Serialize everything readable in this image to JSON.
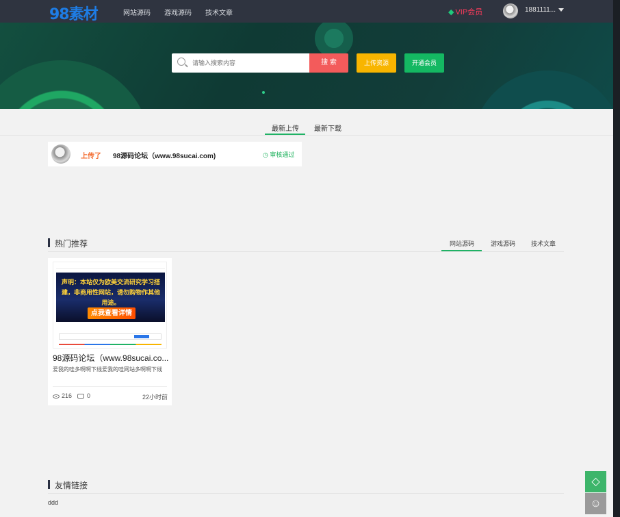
{
  "header": {
    "logo": "98素材",
    "nav": [
      "网站源码",
      "游戏源码",
      "技术文章"
    ],
    "vip_label": "VIP会员",
    "user_name": "1881111..."
  },
  "search": {
    "placeholder": "请输入搜索内容",
    "button": "搜 索",
    "upload": "上传资源",
    "open_vip": "开通会员"
  },
  "tabs": [
    "最新上传",
    "最新下载"
  ],
  "upload_item": {
    "action": "上传了",
    "title": "98源码论坛（www.98sucai.com)",
    "status": "审核通过"
  },
  "hot": {
    "title": "热门推荐",
    "tabs": [
      "网站源码",
      "游戏源码",
      "技术文章"
    ],
    "card": {
      "thumb_notice": "声明：本站仅为欧美交流研究学习搭建，非商用性网站，请勿购物作其他用途。",
      "thumb_cta": "点我查看详情",
      "title": "98源码论坛（www.98sucai.co...",
      "desc": "爱我的哇多啊啊下线爱我的哇网站多啊啊下线",
      "views": "216",
      "comments": "0",
      "time": "22小时前"
    }
  },
  "links": {
    "title": "友情链接",
    "items": [
      "ddd"
    ]
  },
  "colors": {
    "accent_green": "#20b265",
    "search_red": "#f35b5b",
    "upload_yellow": "#f8b500",
    "topbar": "#2f3440"
  }
}
